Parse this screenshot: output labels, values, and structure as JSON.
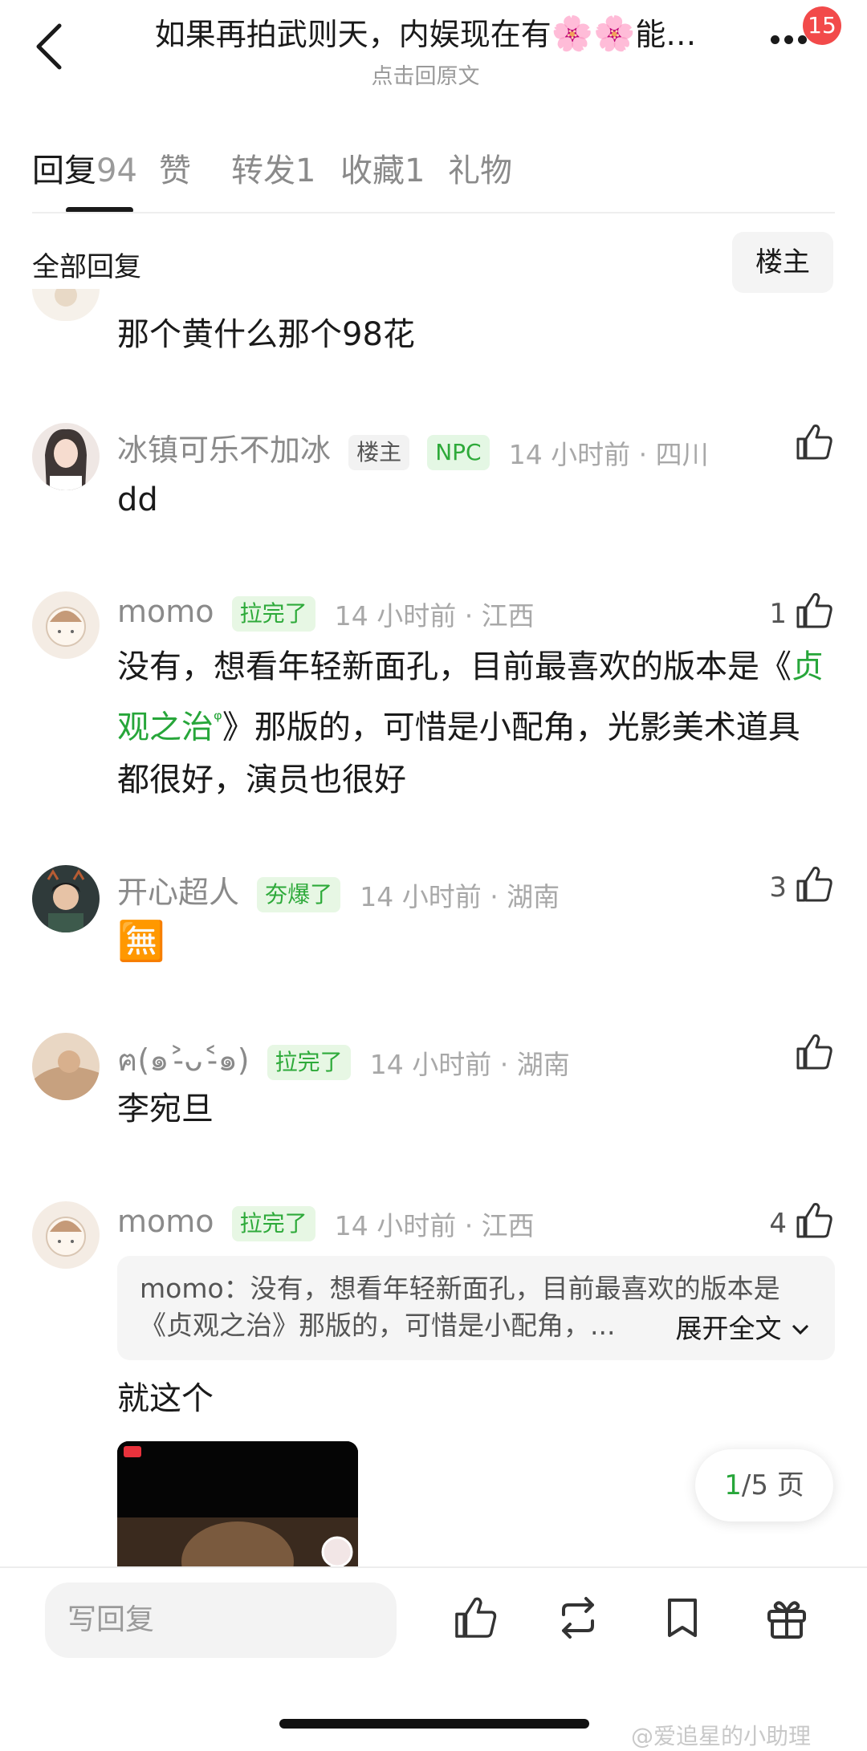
{
  "header": {
    "title_before": "如果再拍武则天，内娱现在有",
    "title_emoji": "🌸🌸",
    "title_after": "能…",
    "subtitle": "点击回原文",
    "notification_count": "15"
  },
  "tabs": [
    {
      "label": "回复",
      "count": "94",
      "active": true
    },
    {
      "label": "赞",
      "count": ""
    },
    {
      "label": "转发",
      "count": "1"
    },
    {
      "label": "收藏",
      "count": "1"
    },
    {
      "label": "礼物",
      "count": ""
    }
  ],
  "filter": {
    "label": "全部回复",
    "owner_button": "楼主"
  },
  "comments": [
    {
      "text": "那个黄什么那个98花"
    },
    {
      "name": "冰镇可乐不加冰",
      "tag_owner": "楼主",
      "tag_npc": "NPC",
      "meta": "14 小时前 · 四川",
      "likes": "",
      "text": "dd"
    },
    {
      "name": "momo",
      "badge": "拉完了",
      "meta": "14 小时前 · 江西",
      "likes": "1",
      "text_before": "没有，想看年轻新面孔，目前最喜欢的版本是《",
      "link": "贞观之治",
      "text_after": "》那版的，可惜是小配角，光影美术道具都很好，演员也很好"
    },
    {
      "name": "开心超人",
      "badge": "夯爆了",
      "meta": "14 小时前 · 湖南",
      "likes": "3",
      "emoji": "🈚"
    },
    {
      "name": "ฅ(๑˃̵ᴗ˂̵๑)",
      "badge": "拉完了",
      "meta": "14 小时前 · 湖南",
      "likes": "",
      "text": "李宛旦"
    },
    {
      "name": "momo",
      "badge": "拉完了",
      "meta": "14 小时前 · 江西",
      "likes": "4",
      "quote": "momo：没有，想看年轻新面孔，目前最喜欢的版本是《贞观之治》那版的，可惜是小配角，...",
      "expand": "展开全文",
      "text": "就这个"
    }
  ],
  "pagination": {
    "current": "1",
    "total": "/5 页"
  },
  "bottom_bar": {
    "reply_placeholder": "写回复"
  },
  "watermark": "@爱追星的小助理",
  "colors": {
    "accent_green": "#27a63a",
    "badge_red": "#f24a4a"
  }
}
